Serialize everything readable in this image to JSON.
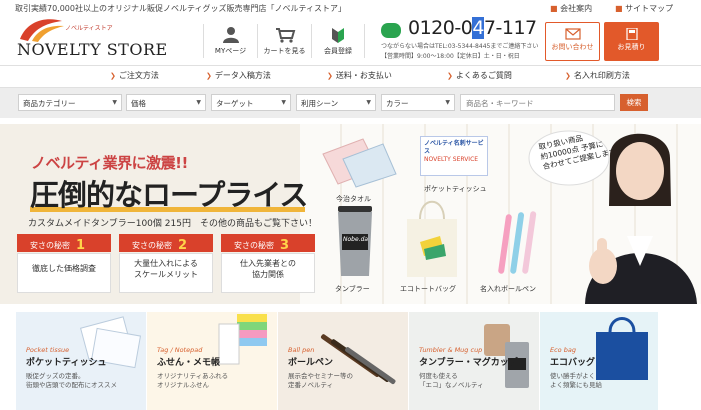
{
  "header": {
    "tagline": "取引実績70,000社以上のオリジナル販促ノベルティグッズ販売専門店「ノベルティストア」",
    "logo_small": "ノベルティストア",
    "logo_text": "NOVELTY STORE",
    "nav": [
      {
        "label": "MYページ",
        "icon": "user-icon"
      },
      {
        "label": "カートを見る",
        "icon": "cart-icon"
      },
      {
        "label": "会員登録",
        "icon": "member-icon"
      }
    ],
    "phone": {
      "prefix": "0120-0",
      "highlight": "4",
      "suffix": "7-117"
    },
    "phone_note_1": "つながらない場合はTEL:03-5344-8445までご連絡下さい",
    "phone_note_2": "【営業時間】9:00～18:00【定休日】土・日・祝日",
    "links": [
      "会社案内",
      "サイトマップ"
    ],
    "contact_label": "お問い合わせ",
    "quote_label": "お見積り",
    "brand_color": "#d7602e"
  },
  "main_nav": [
    "ご注文方法",
    "データ入稿方法",
    "送料・お支払い",
    "よくあるご質問",
    "名入れ印刷方法"
  ],
  "search": {
    "selects": [
      "商品カテゴリー",
      "価格",
      "ターゲット",
      "利用シーン",
      "カラー"
    ],
    "keyword_placeholder": "商品名・キーワード",
    "button": "検索"
  },
  "hero": {
    "sub": "ノベルティ業界に激震!!",
    "main": "圧倒的なロープライス",
    "desc": "カスタムメイドタンブラー100個 215円　その他の商品もご覧下さい！",
    "secrets": [
      {
        "label": "安さの秘密",
        "num": "1",
        "body": [
          "徹底した価格調査"
        ]
      },
      {
        "label": "安さの秘密",
        "num": "2",
        "body": [
          "大量仕入れによる",
          "スケールメリット"
        ]
      },
      {
        "label": "安さの秘密",
        "num": "3",
        "body": [
          "仕入先業者との",
          "協力関係"
        ]
      }
    ],
    "products": [
      "今治タオル",
      "ポケットティッシュ",
      "タンブラー",
      "エコトートバッグ",
      "名入れボールペン"
    ],
    "card_text": "ノベルティ名刺サービス",
    "card_sub": "NOVELTY SERVICE",
    "tumbler_text": "Nobe.da",
    "bubble": [
      "取り扱い商品",
      "約10000点 予算に",
      "合わせてご提案します♥"
    ]
  },
  "categories": [
    {
      "en": "Pocket tissue",
      "ja": "ポケットティッシュ",
      "desc": [
        "販促グッズの定番。",
        "街頭や店頭での配布にオススメ"
      ]
    },
    {
      "en": "Tag / Notepad",
      "ja": "ふせん・メモ帳",
      "desc": [
        "オリジナリティあふれる",
        "オリジナルふせん"
      ]
    },
    {
      "en": "Ball pen",
      "ja": "ボールペン",
      "desc": [
        "展示会やセミナー等の",
        "定番ノベルティ"
      ]
    },
    {
      "en": "Tumbler & Mug cup",
      "ja": "タンブラー・マグカップ",
      "desc": [
        "何度も使える",
        "「エコ」なノベルティ"
      ]
    },
    {
      "en": "Eco bag",
      "ja": "エコバッグ",
      "desc": [
        "使い勝手がよく",
        "よく頻繁にも見給"
      ]
    }
  ]
}
